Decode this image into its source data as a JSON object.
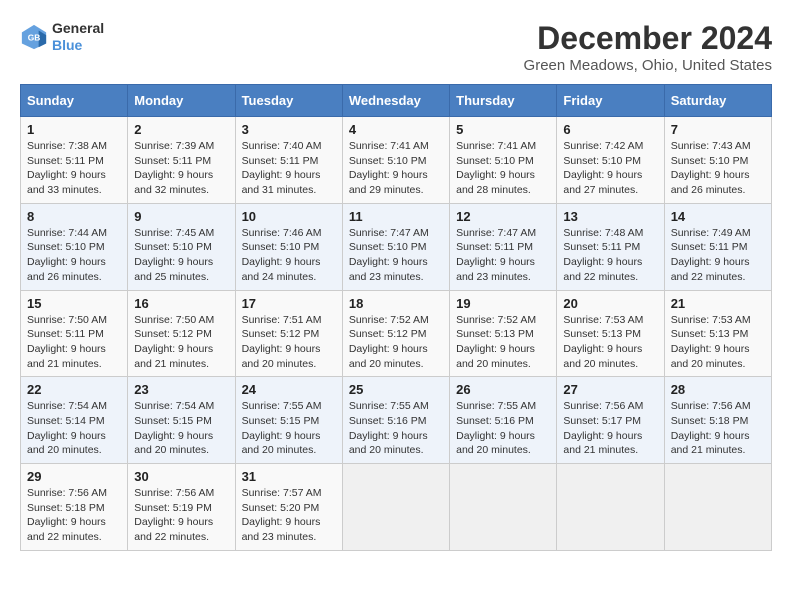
{
  "header": {
    "logo_line1": "General",
    "logo_line2": "Blue",
    "month_title": "December 2024",
    "location": "Green Meadows, Ohio, United States"
  },
  "calendar": {
    "days_of_week": [
      "Sunday",
      "Monday",
      "Tuesday",
      "Wednesday",
      "Thursday",
      "Friday",
      "Saturday"
    ],
    "weeks": [
      [
        {
          "day": "1",
          "sunrise": "Sunrise: 7:38 AM",
          "sunset": "Sunset: 5:11 PM",
          "daylight": "Daylight: 9 hours and 33 minutes."
        },
        {
          "day": "2",
          "sunrise": "Sunrise: 7:39 AM",
          "sunset": "Sunset: 5:11 PM",
          "daylight": "Daylight: 9 hours and 32 minutes."
        },
        {
          "day": "3",
          "sunrise": "Sunrise: 7:40 AM",
          "sunset": "Sunset: 5:11 PM",
          "daylight": "Daylight: 9 hours and 31 minutes."
        },
        {
          "day": "4",
          "sunrise": "Sunrise: 7:41 AM",
          "sunset": "Sunset: 5:10 PM",
          "daylight": "Daylight: 9 hours and 29 minutes."
        },
        {
          "day": "5",
          "sunrise": "Sunrise: 7:41 AM",
          "sunset": "Sunset: 5:10 PM",
          "daylight": "Daylight: 9 hours and 28 minutes."
        },
        {
          "day": "6",
          "sunrise": "Sunrise: 7:42 AM",
          "sunset": "Sunset: 5:10 PM",
          "daylight": "Daylight: 9 hours and 27 minutes."
        },
        {
          "day": "7",
          "sunrise": "Sunrise: 7:43 AM",
          "sunset": "Sunset: 5:10 PM",
          "daylight": "Daylight: 9 hours and 26 minutes."
        }
      ],
      [
        {
          "day": "8",
          "sunrise": "Sunrise: 7:44 AM",
          "sunset": "Sunset: 5:10 PM",
          "daylight": "Daylight: 9 hours and 26 minutes."
        },
        {
          "day": "9",
          "sunrise": "Sunrise: 7:45 AM",
          "sunset": "Sunset: 5:10 PM",
          "daylight": "Daylight: 9 hours and 25 minutes."
        },
        {
          "day": "10",
          "sunrise": "Sunrise: 7:46 AM",
          "sunset": "Sunset: 5:10 PM",
          "daylight": "Daylight: 9 hours and 24 minutes."
        },
        {
          "day": "11",
          "sunrise": "Sunrise: 7:47 AM",
          "sunset": "Sunset: 5:10 PM",
          "daylight": "Daylight: 9 hours and 23 minutes."
        },
        {
          "day": "12",
          "sunrise": "Sunrise: 7:47 AM",
          "sunset": "Sunset: 5:11 PM",
          "daylight": "Daylight: 9 hours and 23 minutes."
        },
        {
          "day": "13",
          "sunrise": "Sunrise: 7:48 AM",
          "sunset": "Sunset: 5:11 PM",
          "daylight": "Daylight: 9 hours and 22 minutes."
        },
        {
          "day": "14",
          "sunrise": "Sunrise: 7:49 AM",
          "sunset": "Sunset: 5:11 PM",
          "daylight": "Daylight: 9 hours and 22 minutes."
        }
      ],
      [
        {
          "day": "15",
          "sunrise": "Sunrise: 7:50 AM",
          "sunset": "Sunset: 5:11 PM",
          "daylight": "Daylight: 9 hours and 21 minutes."
        },
        {
          "day": "16",
          "sunrise": "Sunrise: 7:50 AM",
          "sunset": "Sunset: 5:12 PM",
          "daylight": "Daylight: 9 hours and 21 minutes."
        },
        {
          "day": "17",
          "sunrise": "Sunrise: 7:51 AM",
          "sunset": "Sunset: 5:12 PM",
          "daylight": "Daylight: 9 hours and 20 minutes."
        },
        {
          "day": "18",
          "sunrise": "Sunrise: 7:52 AM",
          "sunset": "Sunset: 5:12 PM",
          "daylight": "Daylight: 9 hours and 20 minutes."
        },
        {
          "day": "19",
          "sunrise": "Sunrise: 7:52 AM",
          "sunset": "Sunset: 5:13 PM",
          "daylight": "Daylight: 9 hours and 20 minutes."
        },
        {
          "day": "20",
          "sunrise": "Sunrise: 7:53 AM",
          "sunset": "Sunset: 5:13 PM",
          "daylight": "Daylight: 9 hours and 20 minutes."
        },
        {
          "day": "21",
          "sunrise": "Sunrise: 7:53 AM",
          "sunset": "Sunset: 5:13 PM",
          "daylight": "Daylight: 9 hours and 20 minutes."
        }
      ],
      [
        {
          "day": "22",
          "sunrise": "Sunrise: 7:54 AM",
          "sunset": "Sunset: 5:14 PM",
          "daylight": "Daylight: 9 hours and 20 minutes."
        },
        {
          "day": "23",
          "sunrise": "Sunrise: 7:54 AM",
          "sunset": "Sunset: 5:15 PM",
          "daylight": "Daylight: 9 hours and 20 minutes."
        },
        {
          "day": "24",
          "sunrise": "Sunrise: 7:55 AM",
          "sunset": "Sunset: 5:15 PM",
          "daylight": "Daylight: 9 hours and 20 minutes."
        },
        {
          "day": "25",
          "sunrise": "Sunrise: 7:55 AM",
          "sunset": "Sunset: 5:16 PM",
          "daylight": "Daylight: 9 hours and 20 minutes."
        },
        {
          "day": "26",
          "sunrise": "Sunrise: 7:55 AM",
          "sunset": "Sunset: 5:16 PM",
          "daylight": "Daylight: 9 hours and 20 minutes."
        },
        {
          "day": "27",
          "sunrise": "Sunrise: 7:56 AM",
          "sunset": "Sunset: 5:17 PM",
          "daylight": "Daylight: 9 hours and 21 minutes."
        },
        {
          "day": "28",
          "sunrise": "Sunrise: 7:56 AM",
          "sunset": "Sunset: 5:18 PM",
          "daylight": "Daylight: 9 hours and 21 minutes."
        }
      ],
      [
        {
          "day": "29",
          "sunrise": "Sunrise: 7:56 AM",
          "sunset": "Sunset: 5:18 PM",
          "daylight": "Daylight: 9 hours and 22 minutes."
        },
        {
          "day": "30",
          "sunrise": "Sunrise: 7:56 AM",
          "sunset": "Sunset: 5:19 PM",
          "daylight": "Daylight: 9 hours and 22 minutes."
        },
        {
          "day": "31",
          "sunrise": "Sunrise: 7:57 AM",
          "sunset": "Sunset: 5:20 PM",
          "daylight": "Daylight: 9 hours and 23 minutes."
        },
        null,
        null,
        null,
        null
      ]
    ]
  }
}
